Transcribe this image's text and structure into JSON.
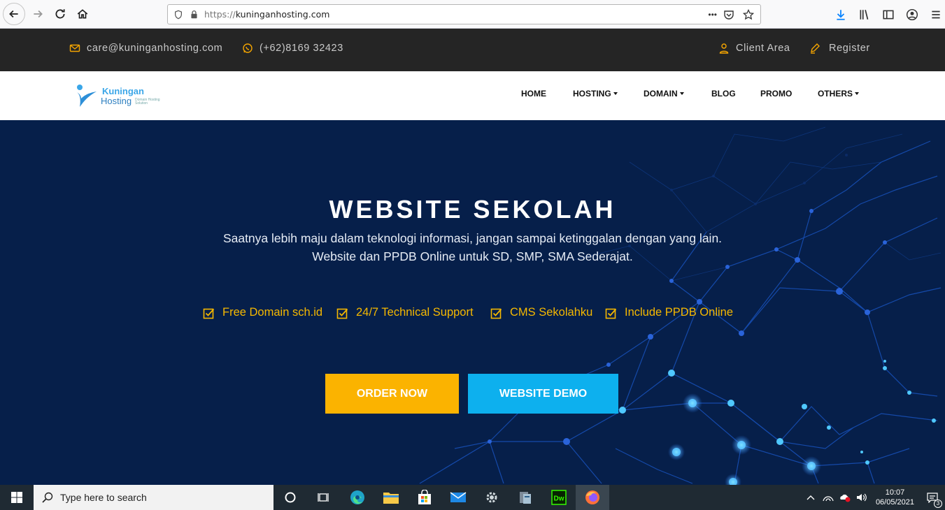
{
  "browser": {
    "url": "https://kuninganhosting.com",
    "url_scheme": "https://",
    "url_host": "kuninganhosting.com",
    "menu_dots": "•••"
  },
  "topbar": {
    "email": "care@kuninganhosting.com",
    "phone": "(+62)8169 32423",
    "client_area": "Client Area",
    "register": "Register"
  },
  "brand": {
    "name_line1": "Kuningan",
    "name_line2": "Hosting",
    "tagline": "Domain Hosting Solution"
  },
  "nav": {
    "home": "HOME",
    "hosting": "HOSTING",
    "domain": "DOMAIN",
    "blog": "BLOG",
    "promo": "PROMO",
    "others": "OTHERS"
  },
  "hero": {
    "title": "WEBSITE SEKOLAH",
    "subtitle_line1": "Saatnya lebih maju dalam teknologi informasi, jangan sampai ketinggalan dengan yang lain.",
    "subtitle_line2": "Website dan PPDB Online untuk SD, SMP, SMA Sederajat.",
    "features": [
      "Free Domain sch.id",
      "24/7 Technical Support",
      "CMS Sekolahku",
      "Include PPDB Online"
    ],
    "order_button": "ORDER NOW",
    "demo_button": "WEBSITE DEMO"
  },
  "taskbar": {
    "search_placeholder": "Type here to search",
    "time": "10:07",
    "date": "06/05/2021",
    "notification_count": "3"
  },
  "colors": {
    "topbar_bg": "#252525",
    "hero_bg": "#061f4a",
    "accent_orange": "#fbb300",
    "accent_blue": "#0db0ee",
    "feature_text": "#f5b800"
  }
}
